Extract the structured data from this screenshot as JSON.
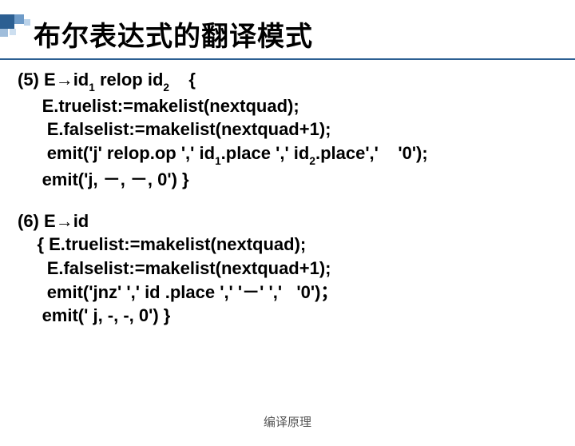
{
  "title": "布尔表达式的翻译模式",
  "rule5": {
    "num": "(5)",
    "head_a": "E→id",
    "head_sub1": "1",
    "head_b": " relop id",
    "head_sub2": "2",
    "head_c": "    {",
    "l1": "E.truelist:=makelist(nextquad);",
    "l2": "E.falselist:=makelist(nextquad+1);",
    "e1a": "emit('j' relop.op ',' id",
    "e1s1": "1",
    "e1b": ".place ',' id",
    "e1s2": "2",
    "e1c": ".place',' ",
    "e1d": " '0');",
    "e2": "emit('j, －, －, 0') }"
  },
  "rule6": {
    "num": "(6)",
    "head": "E→id",
    "l0": "{ E.truelist:=makelist(nextquad);",
    "l1": "E.falselist:=makelist(nextquad+1);",
    "e1": "emit('jnz' ',' id .place ',' '－' ','   '0')；",
    "e2": "emit(' j, -, -, 0') }"
  },
  "footer": "编译原理"
}
